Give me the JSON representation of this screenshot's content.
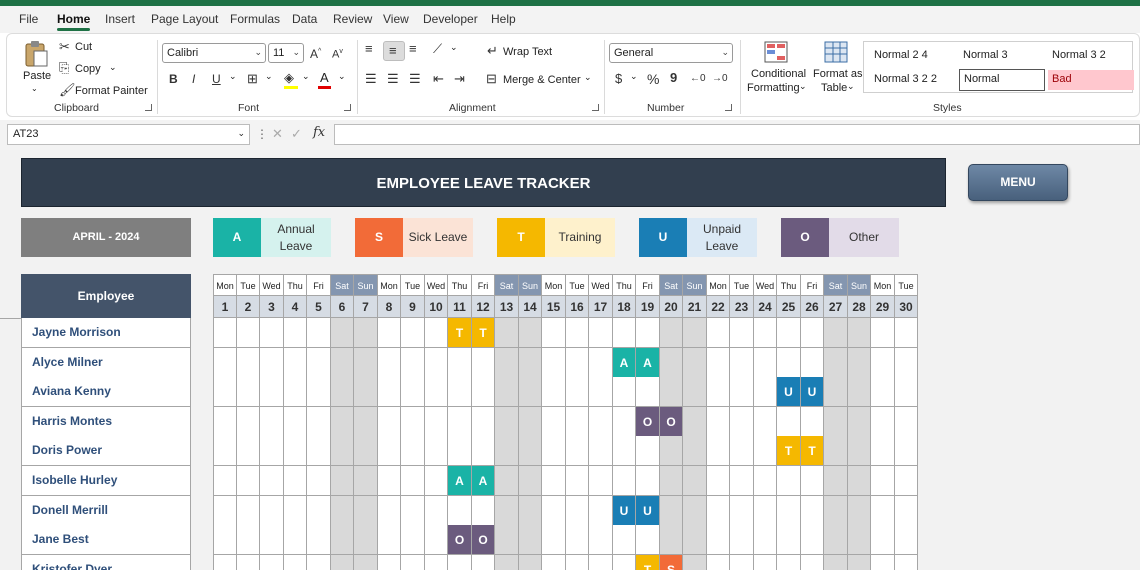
{
  "ribbon_tabs": [
    "File",
    "Home",
    "Insert",
    "Page Layout",
    "Formulas",
    "Data",
    "Review",
    "View",
    "Developer",
    "Help"
  ],
  "active_tab": "Home",
  "clipboard": {
    "paste": "Paste",
    "cut": "Cut",
    "copy": "Copy",
    "format_painter": "Format Painter",
    "label": "Clipboard"
  },
  "font": {
    "name": "Calibri",
    "size": "11",
    "label": "Font",
    "bold": "B",
    "italic": "I",
    "underline": "U"
  },
  "alignment": {
    "wrap_text": "Wrap Text",
    "merge_center": "Merge & Center",
    "label": "Alignment"
  },
  "number": {
    "format": "General",
    "label": "Number",
    "currency": "$",
    "percent": "%",
    "comma": "9"
  },
  "styles": {
    "conditional_formatting": [
      "Conditional",
      "Formatting"
    ],
    "format_as_table": [
      "Format as",
      "Table"
    ],
    "label": "Styles",
    "cells": [
      {
        "text": "Normal 2 4"
      },
      {
        "text": "Normal 3"
      },
      {
        "text": "Normal 3 2"
      },
      {
        "text": "Normal 3 2 2"
      },
      {
        "text": "Normal"
      },
      {
        "text": "Bad"
      }
    ]
  },
  "formula_bar": {
    "cell_ref": "AT23",
    "fx": "fx",
    "value": ""
  },
  "sheet": {
    "title": "EMPLOYEE LEAVE TRACKER",
    "menu_button": "MENU",
    "month": "APRIL - 2024",
    "employee_header": "Employee",
    "legend": [
      {
        "code": "A",
        "name": "Annual Leave",
        "color": "#1ab3a6",
        "light": "#d5f2ee"
      },
      {
        "code": "S",
        "name": "Sick Leave",
        "color": "#f26b38",
        "light": "#fbe3d6"
      },
      {
        "code": "T",
        "name": "Training",
        "color": "#f5b800",
        "light": "#fef1cc"
      },
      {
        "code": "U",
        "name": "Unpaid Leave",
        "color": "#1a7eb5",
        "light": "#dbe9f5"
      },
      {
        "code": "O",
        "name": "Other",
        "color": "#6b5b7e",
        "light": "#e2dbe8"
      }
    ],
    "days": [
      {
        "d": "Mon",
        "n": "1"
      },
      {
        "d": "Tue",
        "n": "2"
      },
      {
        "d": "Wed",
        "n": "3"
      },
      {
        "d": "Thu",
        "n": "4"
      },
      {
        "d": "Fri",
        "n": "5"
      },
      {
        "d": "Sat",
        "n": "6"
      },
      {
        "d": "Sun",
        "n": "7"
      },
      {
        "d": "Mon",
        "n": "8"
      },
      {
        "d": "Tue",
        "n": "9"
      },
      {
        "d": "Wed",
        "n": "10"
      },
      {
        "d": "Thu",
        "n": "11"
      },
      {
        "d": "Fri",
        "n": "12"
      },
      {
        "d": "Sat",
        "n": "13"
      },
      {
        "d": "Sun",
        "n": "14"
      },
      {
        "d": "Mon",
        "n": "15"
      },
      {
        "d": "Tue",
        "n": "16"
      },
      {
        "d": "Wed",
        "n": "17"
      },
      {
        "d": "Thu",
        "n": "18"
      },
      {
        "d": "Fri",
        "n": "19"
      },
      {
        "d": "Sat",
        "n": "20"
      },
      {
        "d": "Sun",
        "n": "21"
      },
      {
        "d": "Mon",
        "n": "22"
      },
      {
        "d": "Tue",
        "n": "23"
      },
      {
        "d": "Wed",
        "n": "24"
      },
      {
        "d": "Thu",
        "n": "25"
      },
      {
        "d": "Fri",
        "n": "26"
      },
      {
        "d": "Sat",
        "n": "27"
      },
      {
        "d": "Sun",
        "n": "28"
      },
      {
        "d": "Mon",
        "n": "29"
      },
      {
        "d": "Tue",
        "n": "30"
      }
    ],
    "employees": [
      {
        "name": "Jayne Morrison",
        "leaves": {
          "11": "T",
          "12": "T"
        }
      },
      {
        "name": "Alyce Milner",
        "leaves": {
          "18": "A",
          "19": "A"
        }
      },
      {
        "name": "Aviana Kenny",
        "leaves": {
          "25": "U",
          "26": "U"
        }
      },
      {
        "name": "Harris Montes",
        "leaves": {
          "19": "O",
          "20": "O"
        }
      },
      {
        "name": "Doris Power",
        "leaves": {
          "25": "T",
          "26": "T"
        }
      },
      {
        "name": "Isobelle Hurley",
        "leaves": {
          "11": "A",
          "12": "A"
        }
      },
      {
        "name": "Donell Merrill",
        "leaves": {
          "18": "U",
          "19": "U"
        }
      },
      {
        "name": "Jane Best",
        "leaves": {
          "11": "O",
          "12": "O"
        }
      },
      {
        "name": "Kristofer Dyer",
        "leaves": {
          "19": "T",
          "20": "S"
        }
      }
    ]
  }
}
